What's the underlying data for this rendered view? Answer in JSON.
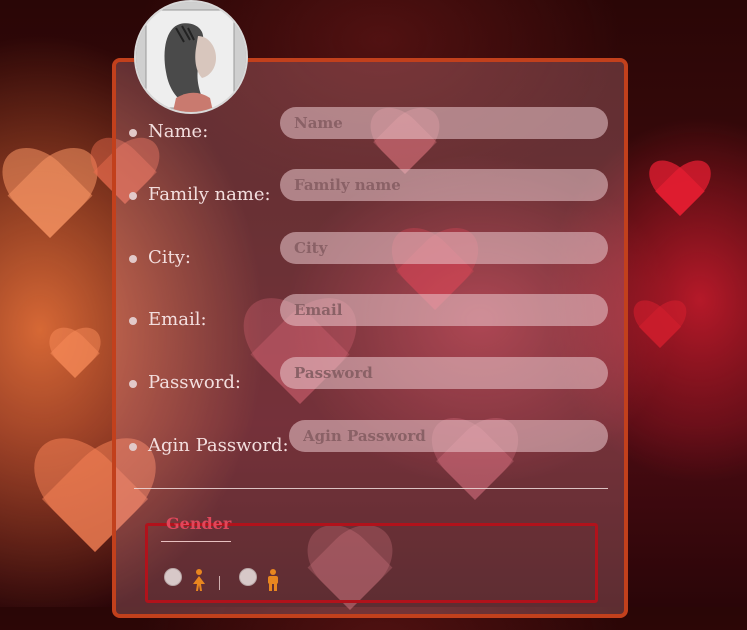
{
  "form": {
    "fields": [
      {
        "label": "Name:",
        "placeholder": "Name"
      },
      {
        "label": "Family name:",
        "placeholder": "Family name"
      },
      {
        "label": "City:",
        "placeholder": "City"
      },
      {
        "label": "Email:",
        "placeholder": "Email"
      },
      {
        "label": "Password:",
        "placeholder": "Password"
      },
      {
        "label": "Agin Password:",
        "placeholder": "Agin Password"
      }
    ],
    "gender": {
      "legend": "Gender",
      "options": [
        {
          "icon": "female-icon",
          "glyph": "♀"
        },
        {
          "icon": "male-icon",
          "glyph": "♂"
        }
      ],
      "separator": "|"
    }
  },
  "colors": {
    "panel_border": "#c2401c",
    "legend_text": "#e0475b",
    "gender_icon": "#e8861f",
    "fieldset_border": "#b1121b"
  }
}
